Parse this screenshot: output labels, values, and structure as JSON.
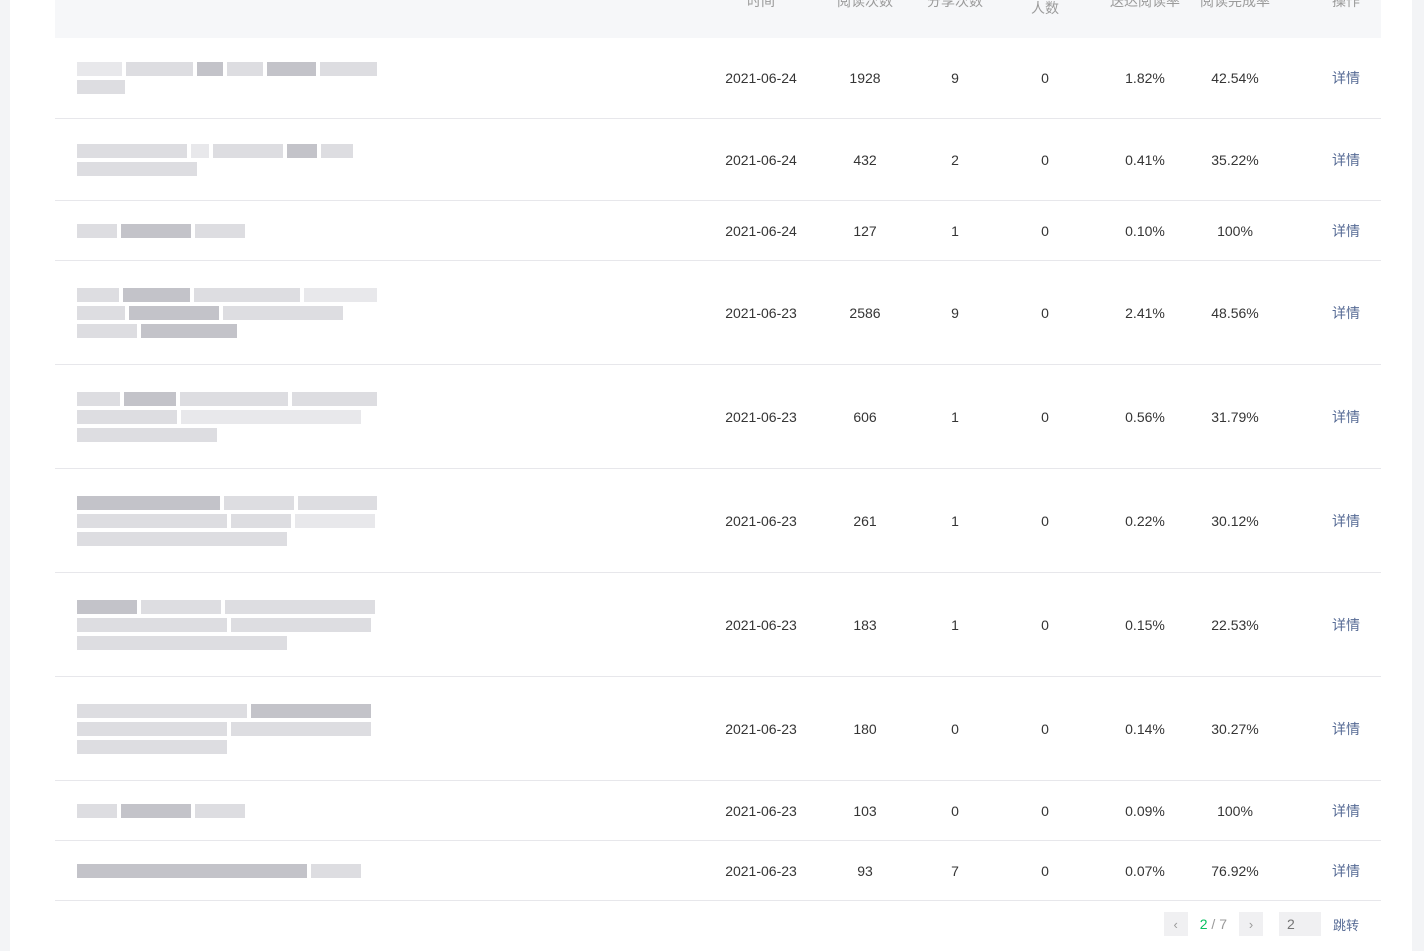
{
  "header": {
    "title_col": "",
    "date_col": "时间",
    "read_col": "阅读次数",
    "share_col": "分享次数",
    "people_col": "人数",
    "rate_col": "送达阅读率",
    "done_col": "阅读完成率",
    "op_col": "操作"
  },
  "rows": [
    {
      "date": "2021-06-24",
      "reads": "1928",
      "shares": "9",
      "people": "0",
      "rate": "1.82%",
      "done": "42.54%",
      "op": "详情"
    },
    {
      "date": "2021-06-24",
      "reads": "432",
      "shares": "2",
      "people": "0",
      "rate": "0.41%",
      "done": "35.22%",
      "op": "详情"
    },
    {
      "date": "2021-06-24",
      "reads": "127",
      "shares": "1",
      "people": "0",
      "rate": "0.10%",
      "done": "100%",
      "op": "详情"
    },
    {
      "date": "2021-06-23",
      "reads": "2586",
      "shares": "9",
      "people": "0",
      "rate": "2.41%",
      "done": "48.56%",
      "op": "详情"
    },
    {
      "date": "2021-06-23",
      "reads": "606",
      "shares": "1",
      "people": "0",
      "rate": "0.56%",
      "done": "31.79%",
      "op": "详情"
    },
    {
      "date": "2021-06-23",
      "reads": "261",
      "shares": "1",
      "people": "0",
      "rate": "0.22%",
      "done": "30.12%",
      "op": "详情"
    },
    {
      "date": "2021-06-23",
      "reads": "183",
      "shares": "1",
      "people": "0",
      "rate": "0.15%",
      "done": "22.53%",
      "op": "详情"
    },
    {
      "date": "2021-06-23",
      "reads": "180",
      "shares": "0",
      "people": "0",
      "rate": "0.14%",
      "done": "30.27%",
      "op": "详情"
    },
    {
      "date": "2021-06-23",
      "reads": "103",
      "shares": "0",
      "people": "0",
      "rate": "0.09%",
      "done": "100%",
      "op": "详情"
    },
    {
      "date": "2021-06-23",
      "reads": "93",
      "shares": "7",
      "people": "0",
      "rate": "0.07%",
      "done": "76.92%",
      "op": "详情"
    }
  ],
  "pagination": {
    "prev_icon": "chevron-left-icon",
    "next_icon": "chevron-right-icon",
    "prev_glyph": "‹",
    "next_glyph": "›",
    "current": "2",
    "separator": "/",
    "total": "7",
    "jump_input_placeholder": "2",
    "jump_label": "跳转"
  },
  "colors": {
    "accent_green": "#07c160",
    "link_blue": "#576b95"
  }
}
